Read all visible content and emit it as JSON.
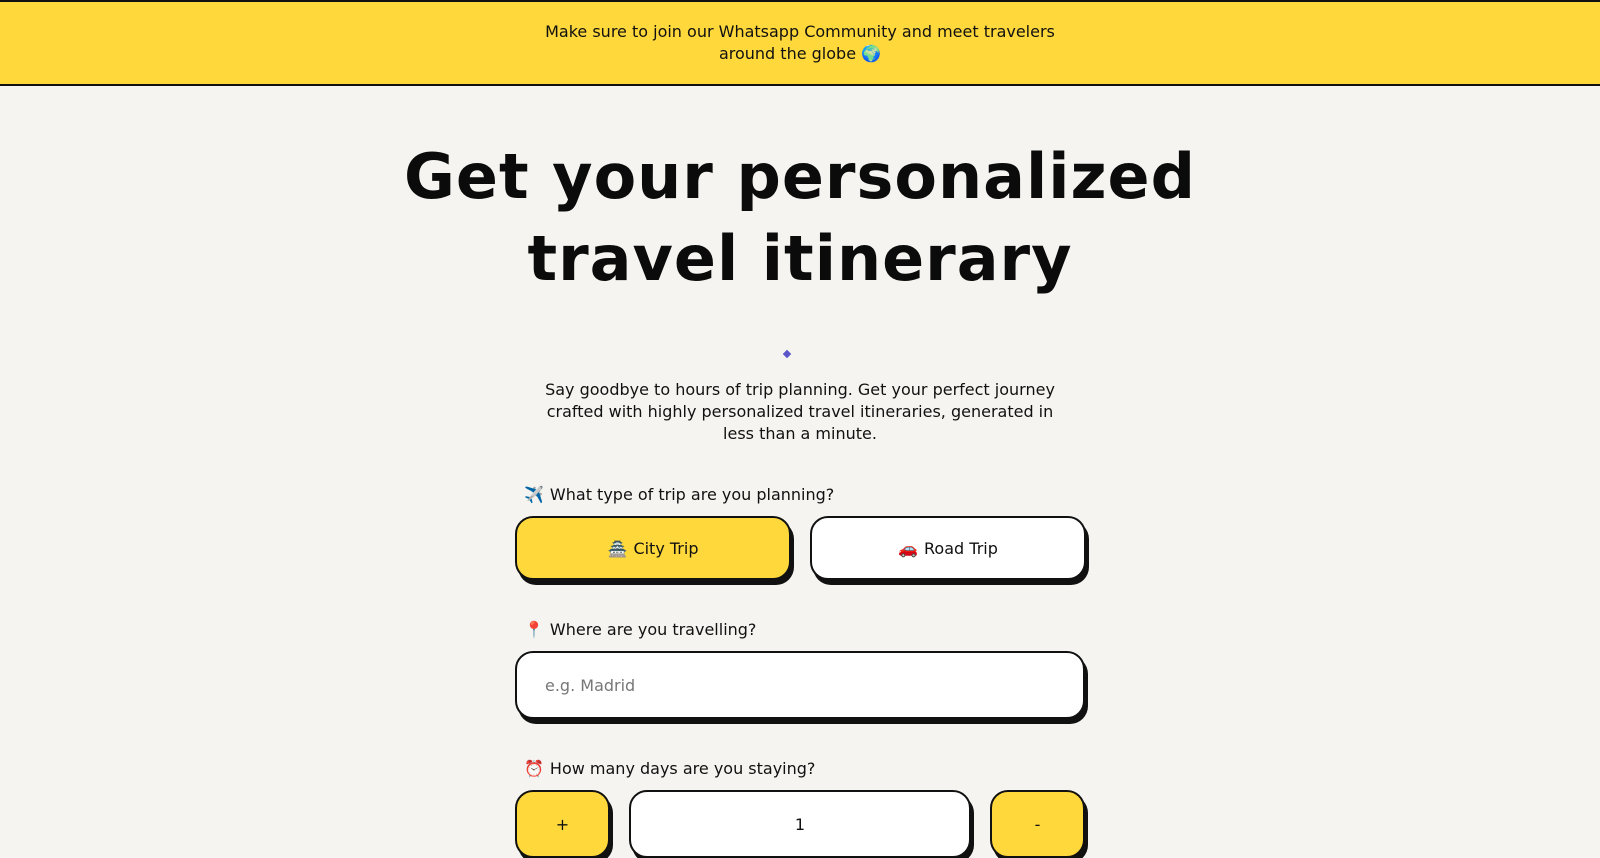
{
  "banner": {
    "text": "Make sure to join our Whatsapp Community and meet travelers around the globe 🌍"
  },
  "hero": {
    "title_line1": "Get your personalized",
    "title_line2": "travel itinerary",
    "subtitle": "Say goodbye to hours of trip planning. Get your perfect journey crafted with highly personalized travel itineraries, generated in less than a minute."
  },
  "trip_type": {
    "label_emoji": "✈️",
    "label": "What type of trip are you planning?",
    "options": [
      {
        "emoji": "🏯",
        "label": "City Trip",
        "selected": true
      },
      {
        "emoji": "🚗",
        "label": "Road Trip",
        "selected": false
      }
    ]
  },
  "destination": {
    "label_emoji": "📍",
    "label": "Where are you travelling?",
    "placeholder": "e.g. Madrid",
    "value": ""
  },
  "days": {
    "label_emoji": "⏰",
    "label": "How many days are you staying?",
    "increment_label": "+",
    "value": "1",
    "decrement_label": "-"
  },
  "colors": {
    "accent": "#ffd83b",
    "background": "#f5f4f0",
    "border": "#111111",
    "sparkle": "#5b56c9"
  }
}
